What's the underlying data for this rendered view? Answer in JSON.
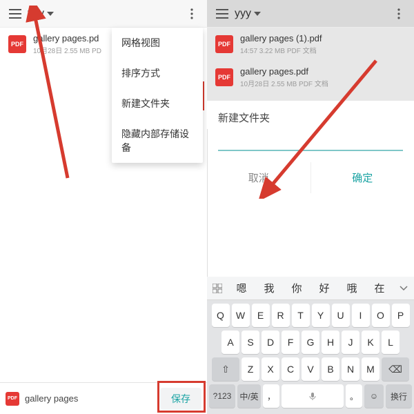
{
  "left": {
    "toolbar": {
      "title": "yyy"
    },
    "file": {
      "name": "gallery pages.pd",
      "meta": "10月28日 2.55 MB PD"
    },
    "menu": {
      "grid_view": "网格视图",
      "sort_by": "排序方式",
      "new_folder": "新建文件夹",
      "hide_internal": "隐藏内部存储设备"
    },
    "bottom": {
      "filename": "gallery pages",
      "save": "保存"
    },
    "icons": {
      "pdf": "PDF"
    }
  },
  "right": {
    "toolbar": {
      "title": "yyy"
    },
    "files": [
      {
        "name": "gallery pages (1).pdf",
        "meta": "14:57 3.22 MB PDF 文档"
      },
      {
        "name": "gallery pages.pdf",
        "meta": "10月28日 2.55 MB PDF 文档"
      }
    ],
    "dialog": {
      "label": "新建文件夹",
      "cancel": "取消",
      "confirm": "确定"
    },
    "icons": {
      "pdf": "PDF"
    },
    "keyboard": {
      "candidates": [
        "嗯",
        "我",
        "你",
        "好",
        "哦",
        "在"
      ],
      "row1": [
        "Q",
        "W",
        "E",
        "R",
        "T",
        "Y",
        "U",
        "I",
        "O",
        "P"
      ],
      "row2": [
        "A",
        "S",
        "D",
        "F",
        "G",
        "H",
        "J",
        "K",
        "L"
      ],
      "row3": [
        "Z",
        "X",
        "C",
        "V",
        "B",
        "N",
        "M"
      ],
      "shift": "⇧",
      "backspace": "⌫",
      "num": "?123",
      "lang": "中/英",
      "comma": "，",
      "period": "。",
      "emoji": "☺",
      "enter": "换行"
    }
  }
}
